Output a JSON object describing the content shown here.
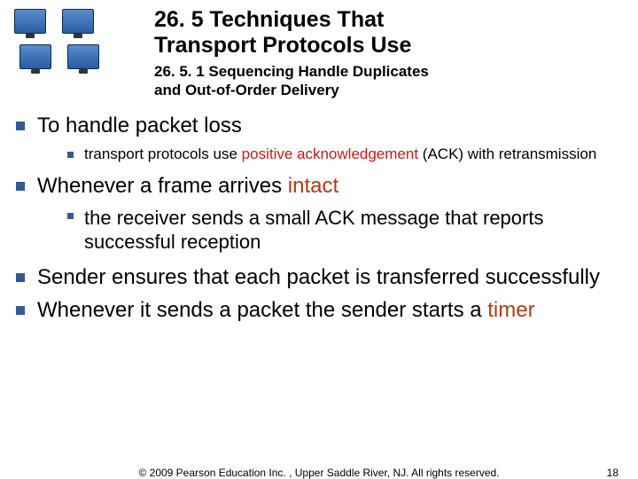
{
  "header": {
    "title_line1": "26. 5  Techniques That",
    "title_line2": "Transport Protocols Use",
    "subtitle_line1": "26. 5. 1 Sequencing Handle Duplicates",
    "subtitle_line2": "and Out-of-Order Delivery"
  },
  "b1": {
    "text": "To handle packet loss"
  },
  "b1s1": {
    "pre": "transport protocols use ",
    "key": "positive acknowledgement",
    "post": " (ACK) with retransmission"
  },
  "b2": {
    "pre": "Whenever a frame arrives ",
    "key": "intact"
  },
  "b2s1": {
    "text": "the receiver sends a small ACK message that reports successful reception"
  },
  "b3": {
    "text": "Sender ensures that each packet is transferred successfully"
  },
  "b4": {
    "pre": "Whenever it sends a packet",
    "mid": " the sender starts a ",
    "key": "timer"
  },
  "footer": {
    "copyright": "© 2009 Pearson Education Inc. , Upper Saddle River, NJ. All rights reserved.",
    "page": "18"
  }
}
